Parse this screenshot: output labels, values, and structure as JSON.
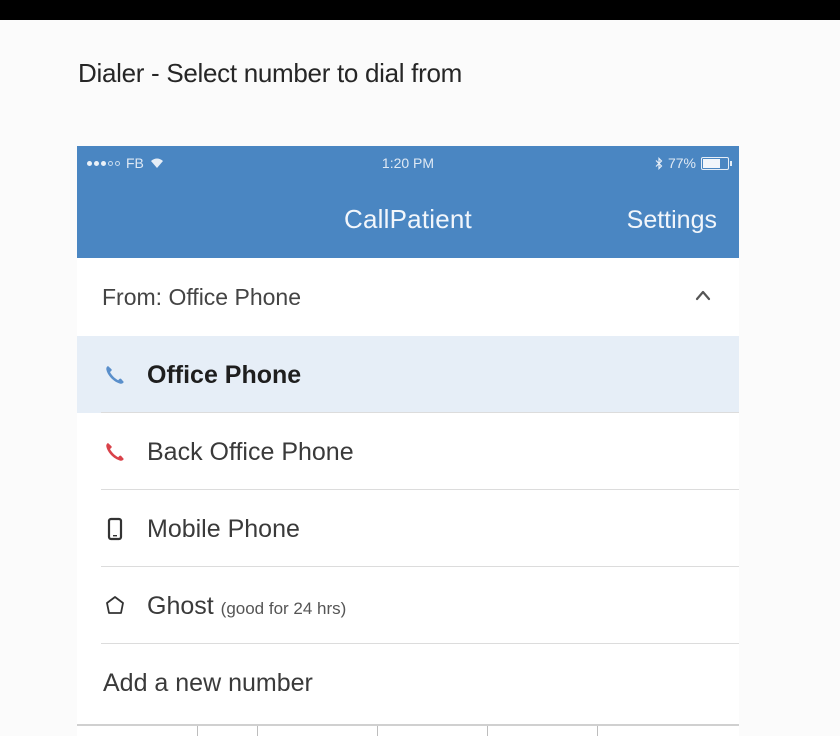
{
  "caption": "Dialer - Select number to dial from",
  "status_bar": {
    "carrier": "FB",
    "time": "1:20 PM",
    "battery": "77%",
    "battery_level": 0.77
  },
  "nav": {
    "title": "CallPatient",
    "settings_label": "Settings"
  },
  "from": {
    "label": "From: Office Phone",
    "icon": "chevron-up-icon"
  },
  "numbers": [
    {
      "label": "Office Phone",
      "sub": "",
      "icon": "phone-handset-icon",
      "icon_color": "#5a8fcb",
      "selected": true
    },
    {
      "label": "Back Office Phone",
      "sub": "",
      "icon": "phone-handset-icon",
      "icon_color": "#d9424a",
      "selected": false
    },
    {
      "label": "Mobile Phone",
      "sub": "",
      "icon": "mobile-phone-icon",
      "icon_color": "#333333",
      "selected": false
    },
    {
      "label": "Ghost",
      "sub": "(good for 24 hrs)",
      "icon": "ghost-icon",
      "icon_color": "#333333",
      "selected": false
    }
  ],
  "add_number": {
    "label": "Add a new number"
  },
  "colors": {
    "header": "#4a86c2",
    "selected_row": "#e6eef7"
  }
}
